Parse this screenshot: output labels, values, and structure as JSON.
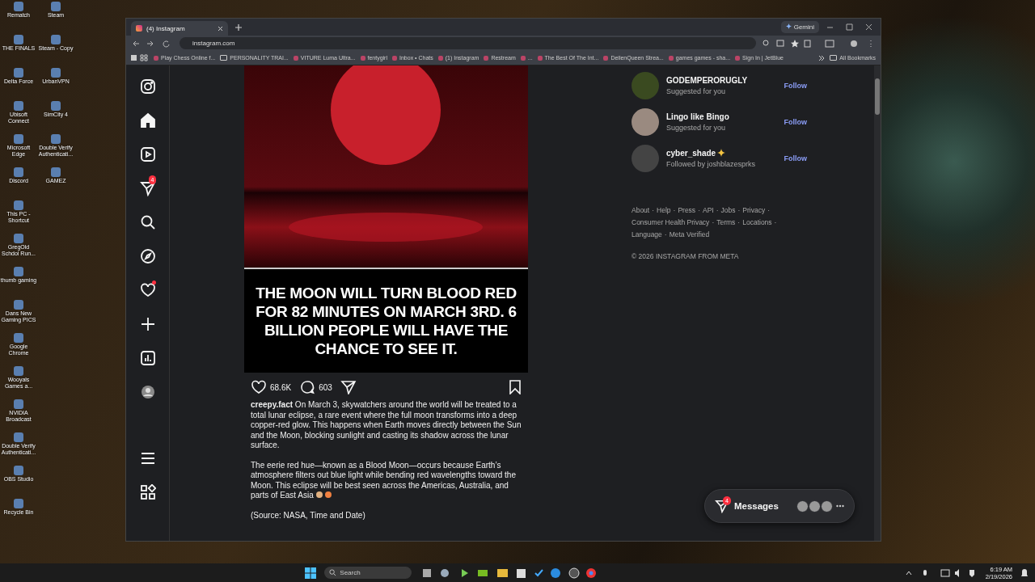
{
  "desktop_icons": {
    "column_1": [
      {
        "label": "Rematch"
      },
      {
        "label": "THE FINALS"
      },
      {
        "label": "Delta Force"
      },
      {
        "label": "Ubisoft Connect"
      },
      {
        "label": "Microsoft Edge"
      },
      {
        "label": "Discord"
      },
      {
        "label": "This PC - Shortcut"
      },
      {
        "label": "GregOld Schdol Run..."
      },
      {
        "label": "thumb gaming"
      },
      {
        "label": "Dans New Gaming PICS"
      },
      {
        "label": "Google Chrome"
      },
      {
        "label": "Wooyals Games a..."
      },
      {
        "label": "NVIDIA Broadcast"
      },
      {
        "label": "Double Verify Authenticati..."
      },
      {
        "label": "OBS Studio"
      },
      {
        "label": "Recycle Bin"
      }
    ],
    "column_2": [
      {
        "label": "Steam"
      },
      {
        "label": "Steam - Copy"
      },
      {
        "label": "UrbanVPN"
      },
      {
        "label": "SimCity 4"
      },
      {
        "label": "Double Verify Authenticati..."
      },
      {
        "label": "GAMEZ"
      }
    ]
  },
  "browser": {
    "tabs": [
      {
        "title": "(4) Instagram",
        "selected": true
      }
    ],
    "gemini_button": "Gemini",
    "address": "instagram.com",
    "bookmarks": [
      {
        "label": "Play Chess Online f...",
        "kind": "site"
      },
      {
        "label": "PERSONALITY TRAI...",
        "kind": "folder"
      },
      {
        "label": "VITURE Luma Ultra...",
        "kind": "site"
      },
      {
        "label": "fentygirl",
        "kind": "site"
      },
      {
        "label": "Inbox • Chats",
        "kind": "site"
      },
      {
        "label": "(1) Instagram",
        "kind": "site"
      },
      {
        "label": "Restream",
        "kind": "site"
      },
      {
        "label": "...",
        "kind": "site"
      },
      {
        "label": "The Best Of The Int...",
        "kind": "site"
      },
      {
        "label": "DeilenQueen Strea...",
        "kind": "site"
      },
      {
        "label": "games games - sha...",
        "kind": "site"
      },
      {
        "label": "Sign In | JetBlue",
        "kind": "site"
      }
    ],
    "all_bookmarks": "All Bookmarks"
  },
  "nav": [
    {
      "kind": "logo"
    },
    {
      "kind": "home"
    },
    {
      "kind": "reels"
    },
    {
      "kind": "messages",
      "badge": "4"
    },
    {
      "kind": "search"
    },
    {
      "kind": "explore"
    },
    {
      "kind": "notifications",
      "dot": true
    },
    {
      "kind": "create"
    },
    {
      "kind": "dashboard"
    },
    {
      "kind": "profile"
    },
    {
      "kind": "menu"
    },
    {
      "kind": "more"
    }
  ],
  "post": {
    "image_caption": "THE MOON WILL TURN BLOOD RED FOR 82 MINUTES ON MARCH 3RD. 6 BILLION PEOPLE WILL HAVE THE CHANCE TO SEE IT.",
    "likes": "68.6K",
    "comments": "603",
    "username": "creepy.fact",
    "caption": [
      "On March 3, skywatchers around the world will be treated to a total lunar eclipse, a rare event where the full moon transforms into a deep copper-red glow. This happens when Earth moves directly between the Sun and the Moon, blocking sunlight and casting its shadow across the lunar surface.",
      "The eerie red hue—known as a Blood Moon—occurs because Earth’s atmosphere filters out blue light while bending red wavelengths toward the Moon. This eclipse will be best seen across the Americas, Australia, and parts of East Asia",
      "(Source: NASA, Time and Date)"
    ]
  },
  "suggestions": [
    {
      "name": "GODEMPERORUGLY",
      "subtitle": "Suggested for you",
      "action": "Follow"
    },
    {
      "name": "Lingo like Bingo",
      "subtitle": "Suggested for you",
      "action": "Follow"
    },
    {
      "name": "cyber_shade",
      "subtitle": "Followed by joshblazesprks",
      "action": "Follow"
    }
  ],
  "footer_links": [
    "About",
    "Help",
    "Press",
    "API",
    "Jobs",
    "Privacy",
    "Consumer Health Privacy",
    "Terms",
    "Locations",
    "Language",
    "Meta Verified"
  ],
  "footer_separator": "·",
  "copyright": "© 2026 INSTAGRAM FROM META",
  "messages": {
    "label": "Messages",
    "badge": "4"
  },
  "taskbar": {
    "search_placeholder": "Search",
    "time": "6:19 AM",
    "date": "2/19/2026"
  }
}
